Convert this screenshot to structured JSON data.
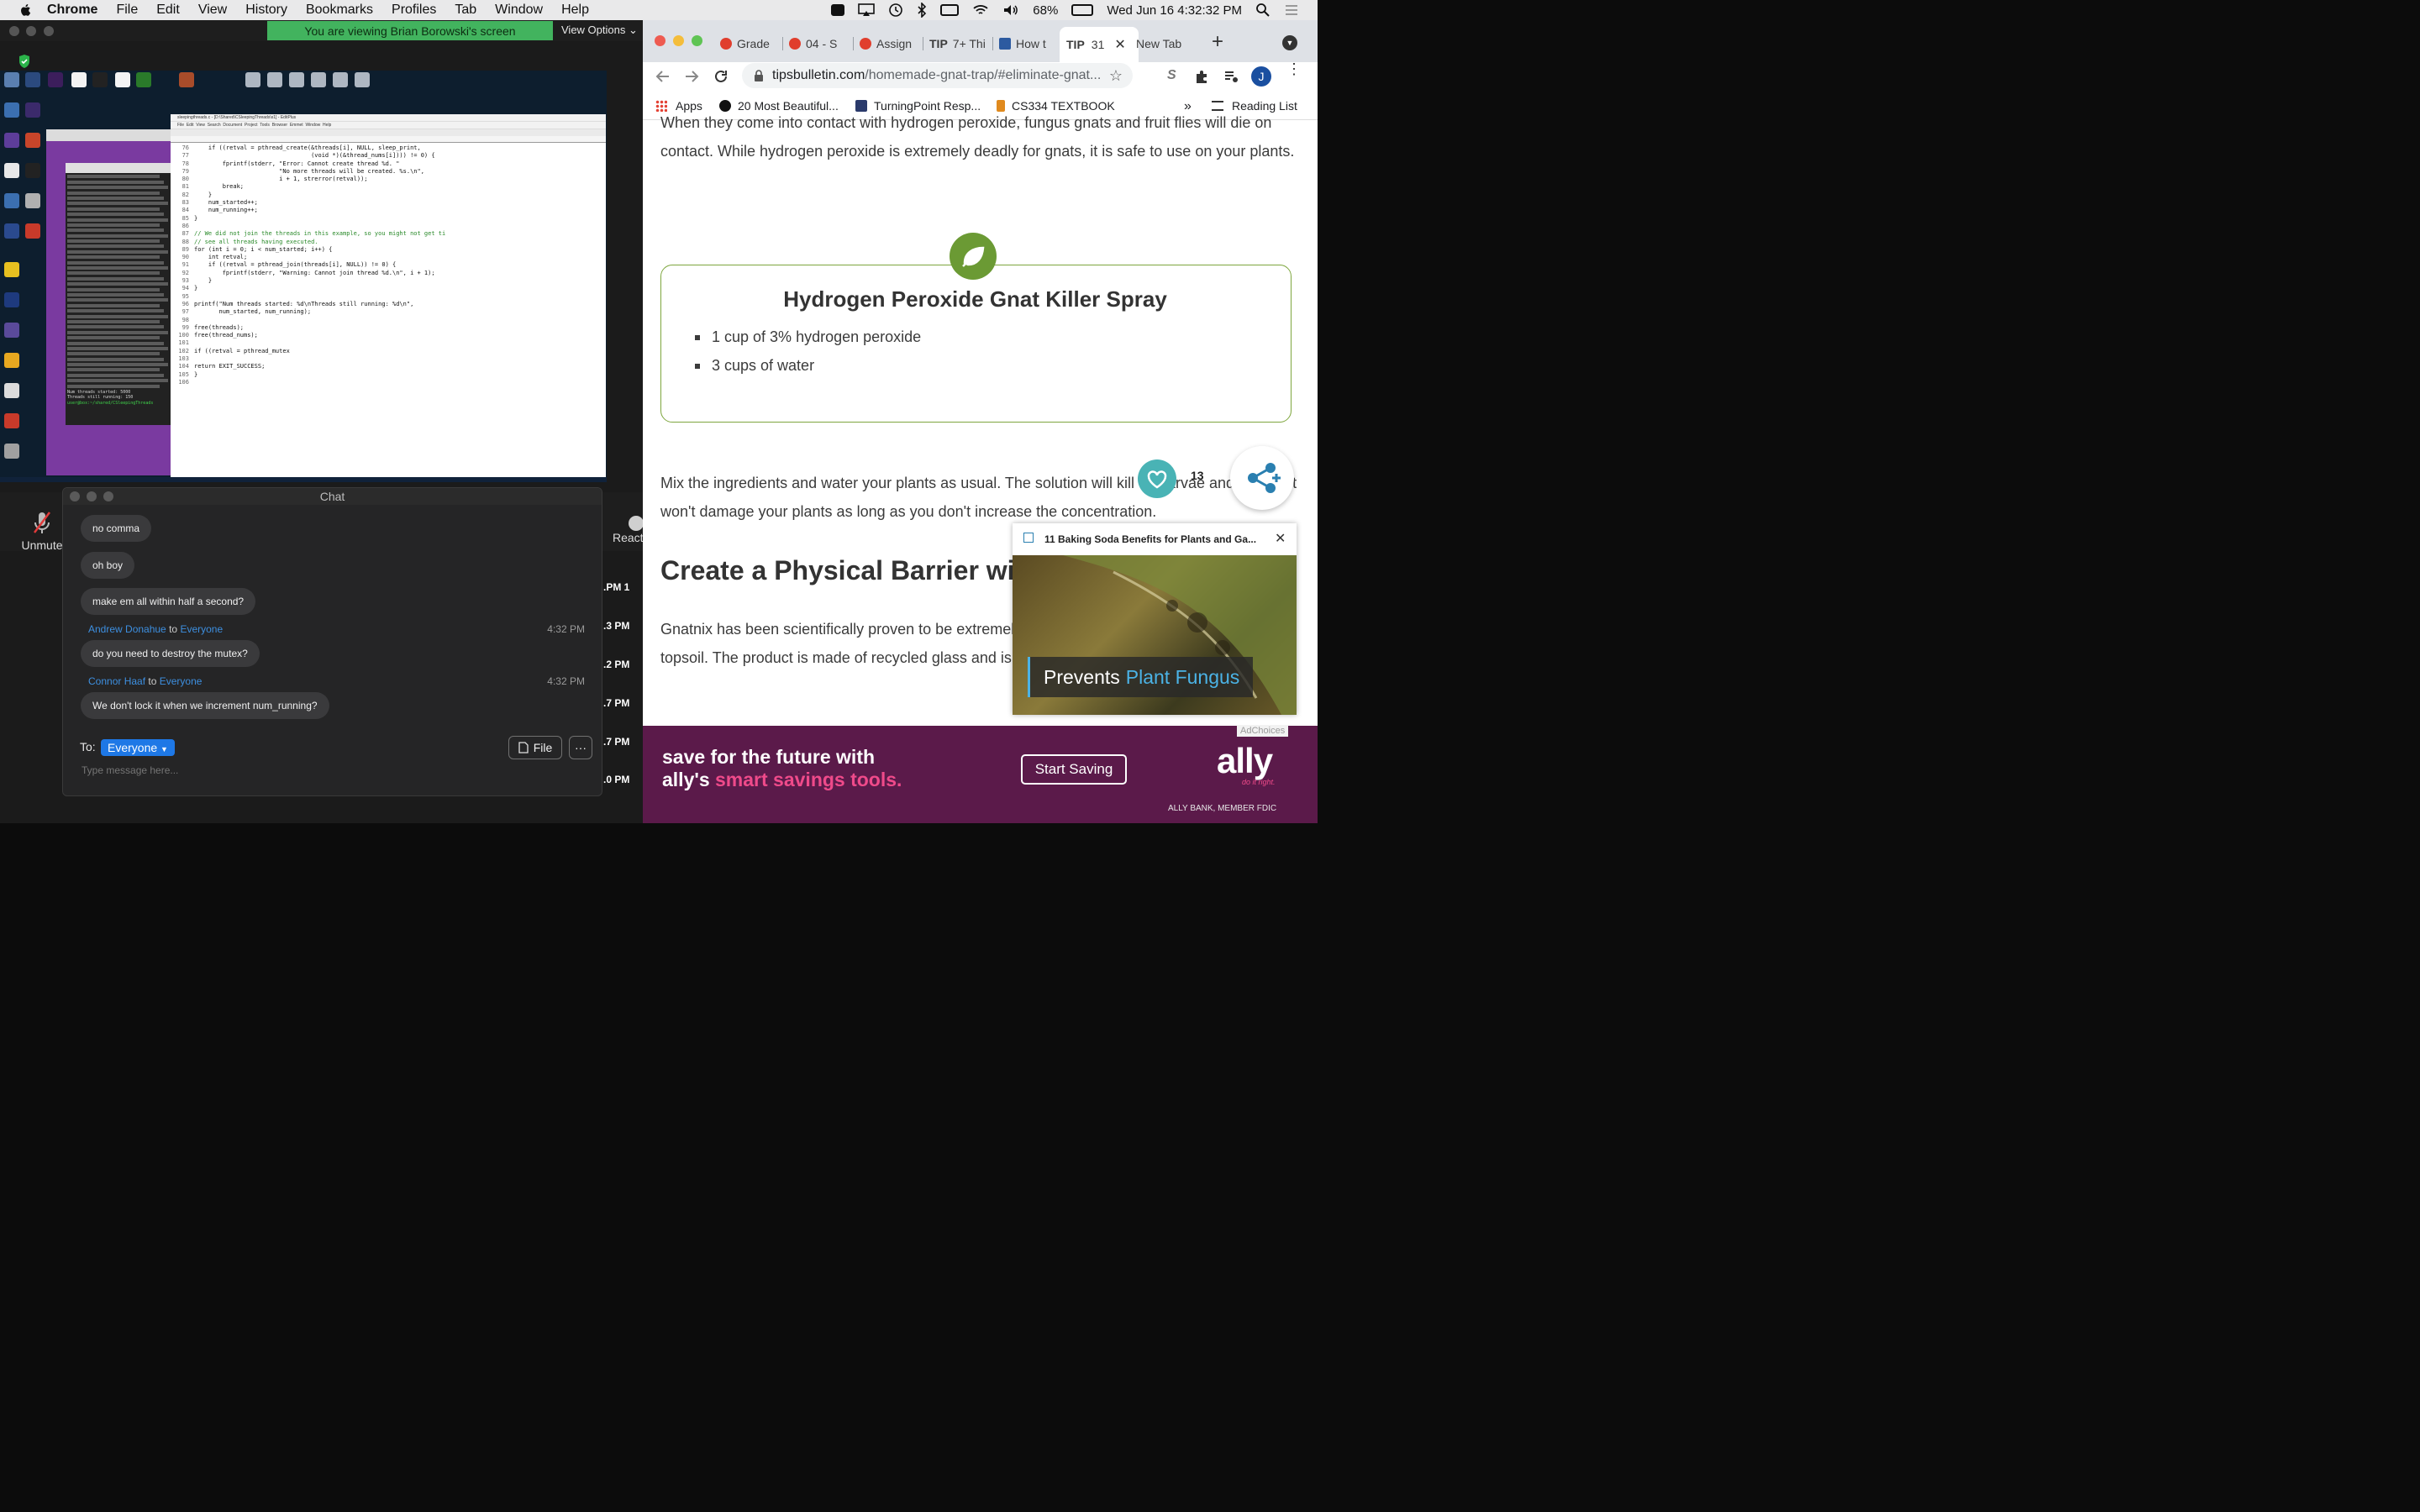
{
  "menubar": {
    "app": "Chrome",
    "items": [
      "File",
      "Edit",
      "View",
      "History",
      "Bookmarks",
      "Profiles",
      "Tab",
      "Window",
      "Help"
    ],
    "battery": "68%",
    "datetime": "Wed Jun 16  4:32:32 PM"
  },
  "zoom": {
    "viewing_banner": "You are viewing Brian Borowski's screen",
    "view_options": "View Options",
    "unmute": "Unmute",
    "react": "React",
    "participant_times": [
      ".PM 1",
      ".3 PM",
      ".2 PM",
      ".7 PM",
      ".7 PM",
      ".0 PM"
    ]
  },
  "shared_screen": {
    "editor_title": "sleepingthreads.c - [D:\\Shared\\CSleepingThreads\\s1] - EditPlus",
    "editor_menu": [
      "File",
      "Edit",
      "View",
      "Search",
      "Document",
      "Project",
      "Tools",
      "Browser",
      "Emmet",
      "Window",
      "Help"
    ],
    "terminal_prompt": "user@box:~/shared/CSleepingThreads",
    "terminal_summary": [
      "Num threads started: 5000",
      "Threads still running: 150"
    ],
    "code_lines": [
      {
        "n": "76",
        "t": "    if ((retval = pthread_create(&threads[i], NULL, sleep_print,"
      },
      {
        "n": "77",
        "t": "                                 (void *)(&thread_nums[i]))) != 0) {"
      },
      {
        "n": "78",
        "t": "        fprintf(stderr, \"Error: Cannot create thread %d. \""
      },
      {
        "n": "79",
        "t": "                        \"No more threads will be created. %s.\\n\","
      },
      {
        "n": "80",
        "t": "                        i + 1, strerror(retval));"
      },
      {
        "n": "81",
        "t": "        break;"
      },
      {
        "n": "82",
        "t": "    }"
      },
      {
        "n": "83",
        "t": "    num_started++;"
      },
      {
        "n": "84",
        "t": "    num_running++;"
      },
      {
        "n": "85",
        "t": "}"
      },
      {
        "n": "86",
        "t": ""
      },
      {
        "n": "87",
        "t": "// We did not join the threads in this example, so you might not get ti"
      },
      {
        "n": "88",
        "t": "// see all threads having executed."
      },
      {
        "n": "89",
        "t": "for (int i = 0; i < num_started; i++) {"
      },
      {
        "n": "90",
        "t": "    int retval;"
      },
      {
        "n": "91",
        "t": "    if ((retval = pthread_join(threads[i], NULL)) != 0) {"
      },
      {
        "n": "92",
        "t": "        fprintf(stderr, \"Warning: Cannot join thread %d.\\n\", i + 1);"
      },
      {
        "n": "93",
        "t": "    }"
      },
      {
        "n": "94",
        "t": "}"
      },
      {
        "n": "95",
        "t": ""
      },
      {
        "n": "96",
        "t": "printf(\"Num threads started: %d\\nThreads still running: %d\\n\","
      },
      {
        "n": "97",
        "t": "       num_started, num_running);"
      },
      {
        "n": "98",
        "t": ""
      },
      {
        "n": "99",
        "t": "free(threads);"
      },
      {
        "n": "100",
        "t": "free(thread_nums);"
      },
      {
        "n": "101",
        "t": ""
      },
      {
        "n": "102",
        "t": "if ((retval = pthread_mutex"
      },
      {
        "n": "103",
        "t": ""
      },
      {
        "n": "104",
        "t": "return EXIT_SUCCESS;"
      },
      {
        "n": "105",
        "t": "}"
      },
      {
        "n": "106",
        "t": ""
      }
    ]
  },
  "chat": {
    "title": "Chat",
    "messages": [
      {
        "text": "no comma"
      },
      {
        "text": "oh boy"
      },
      {
        "text": "make em all within half a second?"
      },
      {
        "sender": "Andrew Donahue",
        "to": "to",
        "recipient": "Everyone",
        "time": "4:32 PM",
        "text": "do you need to destroy the mutex?"
      },
      {
        "sender": "Connor Haaf",
        "to": "to",
        "recipient": "Everyone",
        "time": "4:32 PM",
        "text": "We don't lock it when we increment num_running?"
      }
    ],
    "to_label": "To:",
    "to_value": "Everyone",
    "file_button": "File",
    "more_button": "···",
    "input_placeholder": "Type message here..."
  },
  "chrome": {
    "tabs": [
      {
        "label": "Grade"
      },
      {
        "label": "04 - S"
      },
      {
        "label": "Assign"
      },
      {
        "label": "7+ Thi"
      },
      {
        "label": "How t"
      },
      {
        "label": "31",
        "active": true
      },
      {
        "label": "New Tab"
      }
    ],
    "url_host": "tipsbulletin.com",
    "url_path": "/homemade-gnat-trap/#eliminate-gnat...",
    "bookmarks": [
      "Apps",
      "20 Most Beautiful...",
      "TurningPoint Resp...",
      "CS334 TEXTBOOK"
    ],
    "reading_list": "Reading List",
    "profile_initial": "J"
  },
  "article": {
    "intro": "When they come into contact with hydrogen peroxide, fungus gnats and fruit flies will die on contact. While hydrogen peroxide is extremely deadly for gnats, it is safe to use on your plants.",
    "recipe_title": "Hydrogen Peroxide Gnat Killer Spray",
    "ingredients": [
      "1 cup of 3% hydrogen peroxide",
      "3 cups of water"
    ],
    "mix_text": "Mix the ingredients and water your plants as usual. The solution will kill the larvae and eggs but won't damage your plants as long as you don't increase the concentration.",
    "h2": "Create a Physical Barrier with",
    "barrier_text": "Gnatnix has been scientifically proven to be extremely effective as a barrier between gnats and topsoil. The product is made of recycled glass and is a non-toxic alternative to other products.",
    "like_count": "13"
  },
  "video_popup": {
    "title": "11 Baking Soda Benefits for Plants and Ga...",
    "caption_prefix": "Prevents",
    "caption_highlight": "Plant Fungus"
  },
  "ad": {
    "line1": "save for the future with",
    "line2_a": "ally's ",
    "line2_b": "smart savings tools.",
    "button": "Start Saving",
    "logo": "ally",
    "tagline": "do it right.",
    "fdic": "ALLY BANK, MEMBER FDIC",
    "adchoices": "AdChoices"
  },
  "colors": {
    "accent_green": "#7ea63e",
    "zoom_banner": "#42b35e",
    "chat_blue": "#3d8fe0",
    "ad_purple": "#5b1a4a",
    "ad_pink": "#ef4a8a"
  }
}
